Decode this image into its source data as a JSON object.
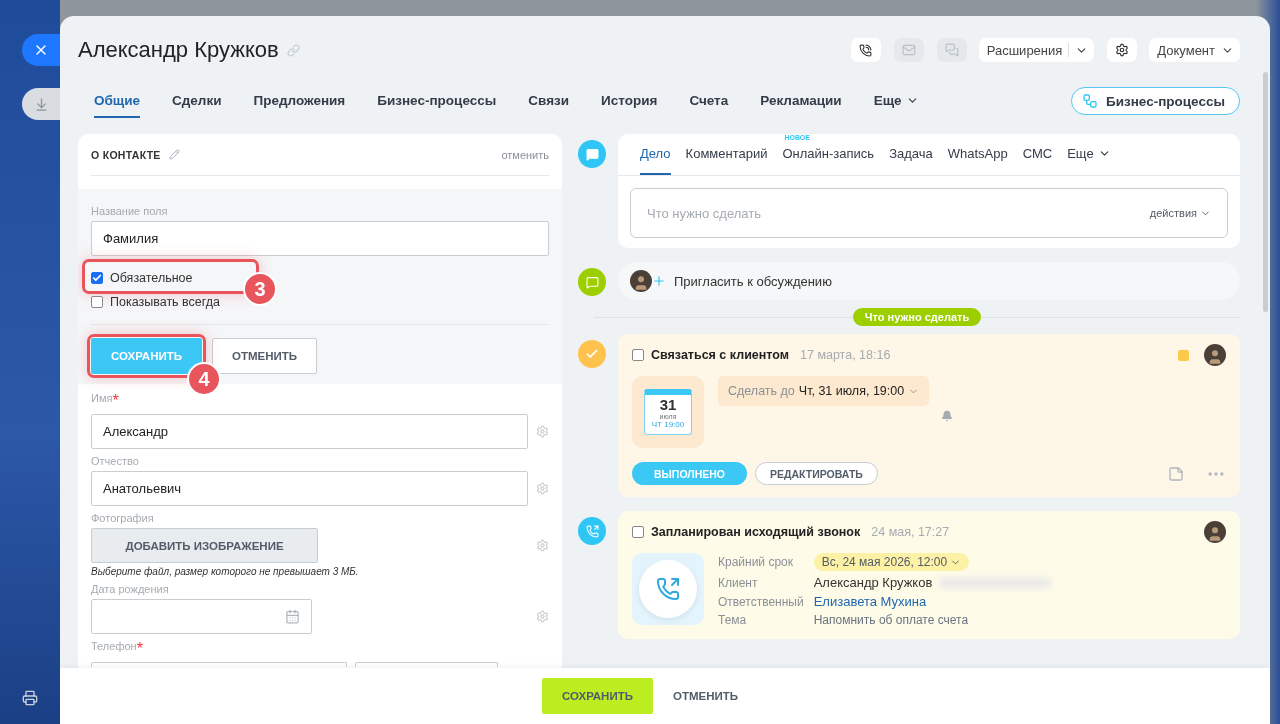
{
  "header": {
    "title": "Александр Кружков",
    "actions": [
      {
        "kind": "phone",
        "disabled": false
      },
      {
        "kind": "mail",
        "disabled": true
      },
      {
        "kind": "chat",
        "disabled": true
      }
    ],
    "extensions": "Расширения",
    "document": "Документ"
  },
  "tabs": [
    {
      "label": "Общие",
      "selected": true,
      "kind": "tab"
    },
    {
      "label": "Сделки",
      "selected": false,
      "kind": "tab"
    },
    {
      "label": "Предложения",
      "selected": false,
      "kind": "tab"
    },
    {
      "label": "Бизнес-процессы",
      "selected": false,
      "kind": "tab"
    },
    {
      "label": "Связи",
      "selected": false,
      "kind": "tab"
    },
    {
      "label": "История",
      "selected": false,
      "kind": "tab"
    },
    {
      "label": "Счета",
      "selected": false,
      "kind": "tab"
    },
    {
      "label": "Рекламации",
      "selected": false,
      "kind": "tab"
    },
    {
      "label": "Еще",
      "selected": false,
      "kind": "menu"
    }
  ],
  "process_button": "Бизнес-процессы",
  "contact_card": {
    "title": "О КОНТАКТЕ",
    "cancel_link": "отменить",
    "editor": {
      "field_label": "Название поля",
      "field_value": "Фамилия",
      "options": [
        {
          "label": "Обязательное",
          "checked": true,
          "callout": "3"
        },
        {
          "label": "Показывать всегда",
          "checked": false
        }
      ],
      "save": "СОХРАНИТЬ",
      "save_callout": "4",
      "cancel": "ОТМЕНИТЬ"
    },
    "fields": [
      {
        "kind": "text",
        "label": "Имя",
        "required_mark": "*",
        "value": "Александр"
      },
      {
        "kind": "text",
        "label": "Отчество",
        "value": "Анатольевич"
      },
      {
        "kind": "image",
        "label": "Фотография",
        "button": "ДОБАВИТЬ ИЗОБРАЖЕНИЕ",
        "hint": "Выберите файл, размер которого не превышает 3 МБ."
      },
      {
        "kind": "date",
        "label": "Дата рождения"
      },
      {
        "kind": "phone",
        "label": "Телефон",
        "required_mark": "*"
      }
    ]
  },
  "activity_editor": {
    "tabs": [
      {
        "label": "Дело",
        "selected": true,
        "kind": "tab"
      },
      {
        "label": "Комментарий",
        "selected": false,
        "kind": "tab"
      },
      {
        "label": "Онлайн-запись",
        "selected": false,
        "kind": "tab",
        "badge": "НОВОЕ"
      },
      {
        "label": "Задача",
        "selected": false,
        "kind": "tab"
      },
      {
        "label": "WhatsApp",
        "selected": false,
        "kind": "tab"
      },
      {
        "label": "СМС",
        "selected": false,
        "kind": "tab"
      },
      {
        "label": "Еще",
        "selected": false,
        "kind": "menu"
      }
    ],
    "placeholder": "Что нужно сделать",
    "actions": "действия"
  },
  "invite": "Пригласить к обсуждению",
  "divider_label": "Что нужно сделать",
  "activities": [
    {
      "kind": "task",
      "title": "Связаться с клиентом",
      "time": "17 марта, 18:16",
      "checked": false,
      "color": "#fcc94a",
      "calendar": {
        "day": "31",
        "month": "июля",
        "time": "ЧТ 19:00"
      },
      "deadline_label": "Сделать до",
      "deadline": "Чт, 31 июля, 19:00",
      "done_button": "ВЫПОЛНЕНО",
      "edit_button": "РЕДАКТИРОВАТЬ"
    },
    {
      "kind": "call",
      "title": "Запланирован исходящий звонок",
      "time": "24 мая, 17:27",
      "checked": false,
      "details": [
        {
          "label": "Крайний срок",
          "value": "Вс, 24 мая 2026, 12:00",
          "kind": "deadline"
        },
        {
          "label": "Клиент",
          "value": "Александр Кружков",
          "kind": "text"
        },
        {
          "label": "Ответственный",
          "value": "Елизавета Мухина",
          "kind": "link"
        },
        {
          "label": "Тема",
          "value": "Напомнить об оплате счета",
          "kind": "muted"
        }
      ]
    }
  ],
  "footer": {
    "save": "СОХРАНИТЬ",
    "cancel": "ОТМЕНИТЬ"
  }
}
